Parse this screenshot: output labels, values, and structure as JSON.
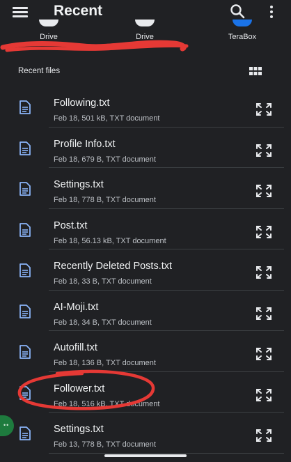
{
  "appbar": {
    "title": "Recent"
  },
  "sources": [
    {
      "label": "Drive",
      "icon": "drive-icon"
    },
    {
      "label": "Drive",
      "icon": "drive-icon"
    },
    {
      "label": "TeraBox",
      "icon": "terabox-icon"
    }
  ],
  "recent": {
    "header": "Recent files",
    "files": [
      {
        "name": "Following.txt",
        "meta": "Feb 18, 501 kB, TXT document"
      },
      {
        "name": "Profile Info.txt",
        "meta": "Feb 18, 679 B, TXT document"
      },
      {
        "name": "Settings.txt",
        "meta": "Feb 18, 778 B, TXT document"
      },
      {
        "name": "Post.txt",
        "meta": "Feb 18, 56.13 kB, TXT document"
      },
      {
        "name": "Recently Deleted Posts.txt",
        "meta": "Feb 18, 33 B, TXT document"
      },
      {
        "name": "AI-Moji.txt",
        "meta": "Feb 18, 34 B, TXT document"
      },
      {
        "name": "Autofill.txt",
        "meta": "Feb 18, 136 B, TXT document"
      },
      {
        "name": "Follower.txt",
        "meta": "Feb 18, 516 kB, TXT document"
      },
      {
        "name": "Settings.txt",
        "meta": "Feb 13, 778 B, TXT document"
      }
    ]
  },
  "fab": {
    "label": "••"
  },
  "colors": {
    "background": "#202124",
    "doc_icon": "#8ab4f8",
    "annotation": "#e53935",
    "fab": "#1e7b3e"
  }
}
